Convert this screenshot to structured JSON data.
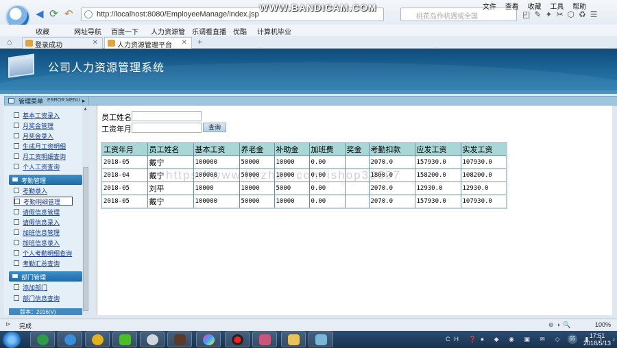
{
  "browser": {
    "url": "http://localhost:8080/EmployeeManage/index.jsp",
    "search_placeholder": "桃花岛作机遇或全国",
    "menu": [
      "文件",
      "查看",
      "收藏",
      "工具",
      "帮助"
    ],
    "recorder_watermark": "WWW.BANDICAM.COM",
    "favorites": [
      "收藏",
      "网址导航",
      "百度一下",
      "人力资源管",
      "乐调看直播",
      "优酷",
      "计算机毕业"
    ],
    "tabs": [
      {
        "label": "登录成功",
        "active": false
      },
      {
        "label": "人力资源管理平台",
        "active": true
      }
    ],
    "status_text": "完成",
    "zoom": "100%"
  },
  "header": {
    "title": "公司人力资源管理系统"
  },
  "sidebar": {
    "title": "管理菜单",
    "title_en": "ERROR MENU",
    "items_salary": [
      "基本工资录入",
      "月奖金管理",
      "月奖金录入",
      "生成月工资明细",
      "月工资明细查询",
      "个人工资查询"
    ],
    "group_attendance": "考勤管理",
    "items_attendance": [
      "考勤录入",
      "考勤明细管理",
      "请假信息管理",
      "请假信息录入",
      "加班信息管理",
      "加班信息录入",
      "个人考勤明细查询",
      "考勤汇总查询"
    ],
    "group_department": "部门管理",
    "items_department": [
      "添加部门",
      "部门信息查询"
    ],
    "footer": "版本：2016(V)"
  },
  "search": {
    "name_label": "员工姓名",
    "month_label": "工资年月",
    "name_value": "",
    "month_value": "",
    "query_button": "查询"
  },
  "table": {
    "headers": [
      "工资年月",
      "员工姓名",
      "基本工资",
      "养老金",
      "补助金",
      "加班费",
      "奖金",
      "考勤扣款",
      "应发工资",
      "实发工资"
    ],
    "rows": [
      [
        "2018-05",
        "戴宁",
        "100000",
        "50000",
        "10000",
        "0.00",
        "",
        "2070.0",
        "157930.0",
        "107930.0"
      ],
      [
        "2018-04",
        "戴宁",
        "100000",
        "50000",
        "10000",
        "0.00",
        "",
        "1800.0",
        "158200.0",
        "108200.0"
      ],
      [
        "2018-05",
        "刘平",
        "10000",
        "10000",
        "5000",
        "0.00",
        "",
        "2070.0",
        "12930.0",
        "12930.0"
      ],
      [
        "2018-05",
        "戴宁",
        "100000",
        "50000",
        "10000",
        "0.00",
        "",
        "2070.0",
        "157930.0",
        "107930.0"
      ]
    ]
  },
  "overlay_watermark": "https://www.huzhan.com/ishop33397",
  "taskbar": {
    "time": "17:51",
    "date": "2018/5/13",
    "tray_badge": "65"
  }
}
